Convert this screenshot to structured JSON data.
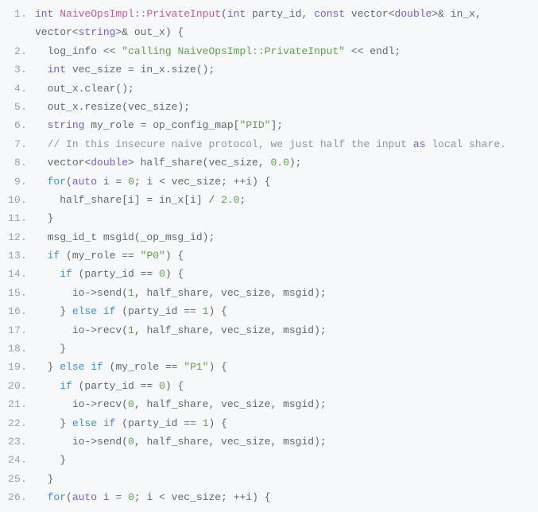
{
  "code": {
    "lines": [
      {
        "n": "1.",
        "tokens": [
          {
            "c": "type",
            "t": "int"
          },
          {
            "c": "pun",
            "t": " "
          },
          {
            "c": "fn",
            "t": "NaiveOpsImpl::PrivateInput"
          },
          {
            "c": "pun",
            "t": "("
          },
          {
            "c": "type",
            "t": "int"
          },
          {
            "c": "pun",
            "t": " party_id, "
          },
          {
            "c": "type",
            "t": "const"
          },
          {
            "c": "pun",
            "t": " vector<"
          },
          {
            "c": "type",
            "t": "double"
          },
          {
            "c": "pun",
            "t": ">& in_x, vector<"
          },
          {
            "c": "type",
            "t": "string"
          },
          {
            "c": "pun",
            "t": ">& out_x) {"
          }
        ]
      },
      {
        "n": "2.",
        "tokens": [
          {
            "c": "pun",
            "t": "  log_info << "
          },
          {
            "c": "str",
            "t": "\"calling NaiveOpsImpl::PrivateInput\""
          },
          {
            "c": "pun",
            "t": " << endl;"
          }
        ]
      },
      {
        "n": "3.",
        "tokens": [
          {
            "c": "pun",
            "t": "  "
          },
          {
            "c": "type",
            "t": "int"
          },
          {
            "c": "pun",
            "t": " vec_size = in_x.size();"
          }
        ]
      },
      {
        "n": "4.",
        "tokens": [
          {
            "c": "pun",
            "t": "  out_x.clear();"
          }
        ]
      },
      {
        "n": "5.",
        "tokens": [
          {
            "c": "pun",
            "t": "  out_x.resize(vec_size);"
          }
        ]
      },
      {
        "n": "6.",
        "tokens": [
          {
            "c": "pun",
            "t": "  "
          },
          {
            "c": "type",
            "t": "string"
          },
          {
            "c": "pun",
            "t": " my_role = op_config_map["
          },
          {
            "c": "str",
            "t": "\"PID\""
          },
          {
            "c": "pun",
            "t": "];"
          }
        ]
      },
      {
        "n": "7.",
        "tokens": [
          {
            "c": "pun",
            "t": "  "
          },
          {
            "c": "cmt",
            "t": "// In this insecure naive protocol, we just half the input "
          },
          {
            "c": "type",
            "t": "as"
          },
          {
            "c": "cmt",
            "t": " local share."
          }
        ]
      },
      {
        "n": "8.",
        "tokens": [
          {
            "c": "pun",
            "t": "  vector<"
          },
          {
            "c": "type",
            "t": "double"
          },
          {
            "c": "pun",
            "t": "> half_share(vec_size, "
          },
          {
            "c": "num",
            "t": "0.0"
          },
          {
            "c": "pun",
            "t": ");"
          }
        ]
      },
      {
        "n": "9.",
        "tokens": [
          {
            "c": "pun",
            "t": "  "
          },
          {
            "c": "kw",
            "t": "for"
          },
          {
            "c": "pun",
            "t": "("
          },
          {
            "c": "type",
            "t": "auto"
          },
          {
            "c": "pun",
            "t": " i = "
          },
          {
            "c": "num",
            "t": "0"
          },
          {
            "c": "pun",
            "t": "; i < vec_size; ++i) {"
          }
        ]
      },
      {
        "n": "10.",
        "tokens": [
          {
            "c": "pun",
            "t": "    half_share[i] = in_x[i] / "
          },
          {
            "c": "num",
            "t": "2.0"
          },
          {
            "c": "pun",
            "t": ";"
          }
        ]
      },
      {
        "n": "11.",
        "tokens": [
          {
            "c": "pun",
            "t": "  }"
          }
        ]
      },
      {
        "n": "12.",
        "tokens": [
          {
            "c": "pun",
            "t": "  msg_id_t msgid(_op_msg_id);"
          }
        ]
      },
      {
        "n": "13.",
        "tokens": [
          {
            "c": "pun",
            "t": "  "
          },
          {
            "c": "kw",
            "t": "if"
          },
          {
            "c": "pun",
            "t": " (my_role == "
          },
          {
            "c": "str",
            "t": "\"P0\""
          },
          {
            "c": "pun",
            "t": ") {"
          }
        ]
      },
      {
        "n": "14.",
        "tokens": [
          {
            "c": "pun",
            "t": "    "
          },
          {
            "c": "kw",
            "t": "if"
          },
          {
            "c": "pun",
            "t": " (party_id == "
          },
          {
            "c": "num",
            "t": "0"
          },
          {
            "c": "pun",
            "t": ") {"
          }
        ]
      },
      {
        "n": "15.",
        "tokens": [
          {
            "c": "pun",
            "t": "      io->send("
          },
          {
            "c": "num",
            "t": "1"
          },
          {
            "c": "pun",
            "t": ", half_share, vec_size, msgid);"
          }
        ]
      },
      {
        "n": "16.",
        "tokens": [
          {
            "c": "pun",
            "t": "    } "
          },
          {
            "c": "kw",
            "t": "else"
          },
          {
            "c": "pun",
            "t": " "
          },
          {
            "c": "kw",
            "t": "if"
          },
          {
            "c": "pun",
            "t": " (party_id == "
          },
          {
            "c": "num",
            "t": "1"
          },
          {
            "c": "pun",
            "t": ") {"
          }
        ]
      },
      {
        "n": "17.",
        "tokens": [
          {
            "c": "pun",
            "t": "      io->recv("
          },
          {
            "c": "num",
            "t": "1"
          },
          {
            "c": "pun",
            "t": ", half_share, vec_size, msgid);"
          }
        ]
      },
      {
        "n": "18.",
        "tokens": [
          {
            "c": "pun",
            "t": "    }"
          }
        ]
      },
      {
        "n": "19.",
        "tokens": [
          {
            "c": "pun",
            "t": "  } "
          },
          {
            "c": "kw",
            "t": "else"
          },
          {
            "c": "pun",
            "t": " "
          },
          {
            "c": "kw",
            "t": "if"
          },
          {
            "c": "pun",
            "t": " (my_role == "
          },
          {
            "c": "str",
            "t": "\"P1\""
          },
          {
            "c": "pun",
            "t": ") {"
          }
        ]
      },
      {
        "n": "20.",
        "tokens": [
          {
            "c": "pun",
            "t": "    "
          },
          {
            "c": "kw",
            "t": "if"
          },
          {
            "c": "pun",
            "t": " (party_id == "
          },
          {
            "c": "num",
            "t": "0"
          },
          {
            "c": "pun",
            "t": ") {"
          }
        ]
      },
      {
        "n": "21.",
        "tokens": [
          {
            "c": "pun",
            "t": "      io->recv("
          },
          {
            "c": "num",
            "t": "0"
          },
          {
            "c": "pun",
            "t": ", half_share, vec_size, msgid);"
          }
        ]
      },
      {
        "n": "22.",
        "tokens": [
          {
            "c": "pun",
            "t": "    } "
          },
          {
            "c": "kw",
            "t": "else"
          },
          {
            "c": "pun",
            "t": " "
          },
          {
            "c": "kw",
            "t": "if"
          },
          {
            "c": "pun",
            "t": " (party_id == "
          },
          {
            "c": "num",
            "t": "1"
          },
          {
            "c": "pun",
            "t": ") {"
          }
        ]
      },
      {
        "n": "23.",
        "tokens": [
          {
            "c": "pun",
            "t": "      io->send("
          },
          {
            "c": "num",
            "t": "0"
          },
          {
            "c": "pun",
            "t": ", half_share, vec_size, msgid);"
          }
        ]
      },
      {
        "n": "24.",
        "tokens": [
          {
            "c": "pun",
            "t": "    }"
          }
        ]
      },
      {
        "n": "25.",
        "tokens": [
          {
            "c": "pun",
            "t": "  }"
          }
        ]
      },
      {
        "n": "26.",
        "tokens": [
          {
            "c": "pun",
            "t": "  "
          },
          {
            "c": "kw",
            "t": "for"
          },
          {
            "c": "pun",
            "t": "("
          },
          {
            "c": "type",
            "t": "auto"
          },
          {
            "c": "pun",
            "t": " i = "
          },
          {
            "c": "num",
            "t": "0"
          },
          {
            "c": "pun",
            "t": "; i < vec_size; ++i) {"
          }
        ]
      }
    ]
  }
}
